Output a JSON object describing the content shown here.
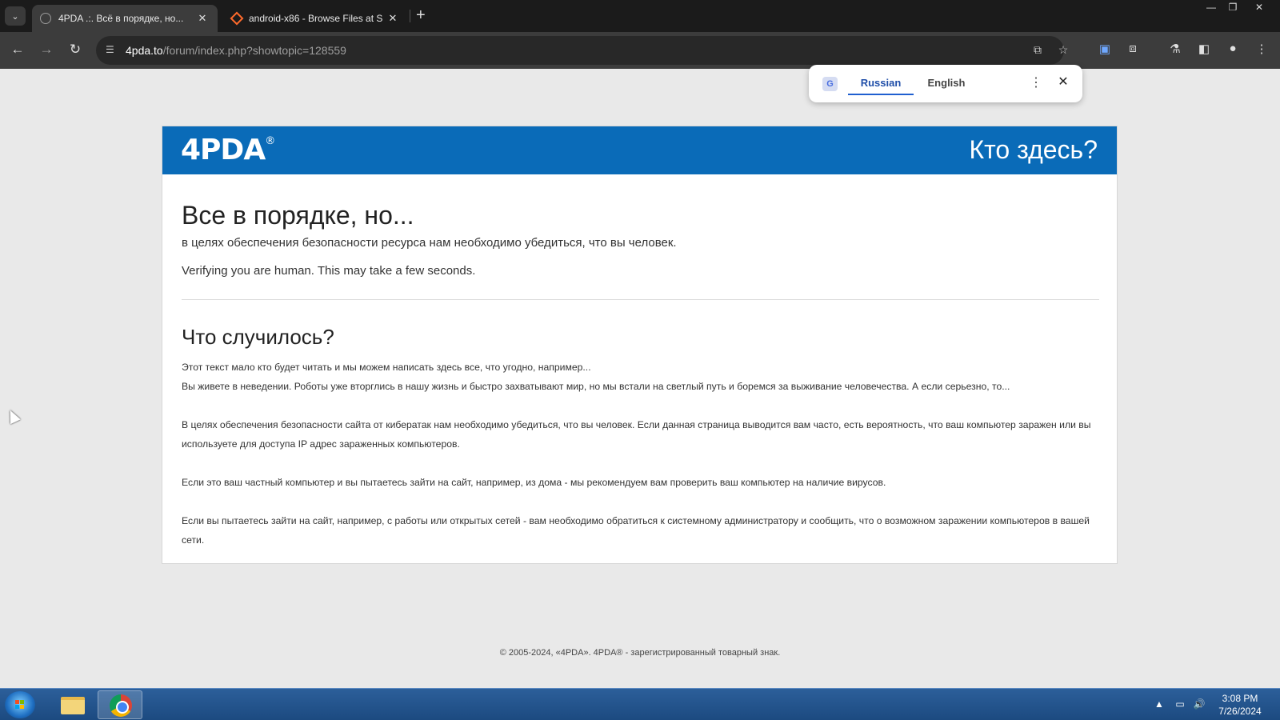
{
  "browser": {
    "tabs": [
      {
        "title": "4PDA .:. Всё в порядке, но...",
        "active": true
      },
      {
        "title": "android-x86 - Browse Files at S",
        "active": false
      }
    ],
    "url_host": "4pda.to",
    "url_path": "/forum/index.php?showtopic=128559"
  },
  "translate": {
    "source": "Russian",
    "target": "English"
  },
  "page": {
    "logo_text": "4PDA",
    "logo_mark": "®",
    "header_title": "Кто здесь?",
    "heading": "Все в порядке, но...",
    "subheading": "в целях обеспечения безопасности ресурса нам необходимо убедиться, что вы человек.",
    "verify_text": "Verifying you are human. This may take a few seconds.",
    "section_title": "Что случилось?",
    "paragraphs": {
      "p1": "Этот текст мало кто будет читать и мы можем написать здесь все, что угодно, например...",
      "p2": "Вы живете в неведении. Роботы уже вторглись в нашу жизнь и быстро захватывают мир, но мы встали на светлый путь и боремся за выживание человечества. А если серьезно, то...",
      "p3": "В целях обеспечения безопасности сайта от кибератак нам необходимо убедиться, что вы человек. Если данная страница выводится вам часто, есть вероятность, что ваш компьютер заражен или вы используете для доступа IP адрес зараженных компьютеров.",
      "p4": "Если это ваш частный компьютер и вы пытаетесь зайти на сайт, например, из дома - мы рекомендуем вам проверить ваш компьютер на наличие вирусов.",
      "p5": "Если вы пытаетесь зайти на сайт, например, с работы или открытых сетей - вам необходимо обратиться к системному администратору и сообщить, что о возможном заражении компьютеров в вашей сети."
    },
    "footer": "© 2005-2024, «4PDA». 4PDA® - зарегистрированный товарный знак."
  },
  "taskbar": {
    "time": "3:08 PM",
    "date": "7/26/2024"
  },
  "colors": {
    "header_blue": "#0a6bb8",
    "translate_accent": "#1f5fd0"
  }
}
